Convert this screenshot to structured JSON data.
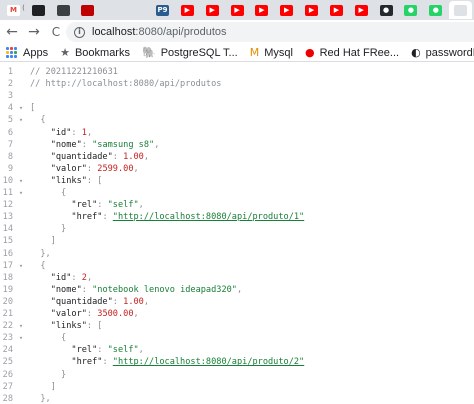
{
  "tabs": [
    {
      "icon": "gmail-icon",
      "label": "M",
      "color": "#ea4335",
      "bg": "#ffffff",
      "close": "(",
      "active": false
    },
    {
      "icon": "tab-dark-icon",
      "label": "",
      "color": "#202124",
      "bg": "#202124",
      "close": "",
      "active": false
    },
    {
      "icon": "tab-dark-icon",
      "label": "",
      "color": "#202124",
      "bg": "#3c4043",
      "close": "",
      "active": false
    },
    {
      "icon": "youtube-music-icon",
      "label": "",
      "color": "#c00000",
      "bg": "#c00000",
      "close": "",
      "active": false
    },
    {
      "icon": "tab-blank-icon",
      "label": "",
      "color": "#5f6368",
      "bg": "#dee1e6",
      "close": "",
      "active": false
    },
    {
      "icon": "tab-blank-icon",
      "label": "",
      "color": "#5f6368",
      "bg": "#dee1e6",
      "close": "",
      "active": false
    },
    {
      "icon": "pg-icon",
      "label": "P9",
      "color": "#ffffff",
      "bg": "#2a5d8f",
      "close": "",
      "active": false
    },
    {
      "icon": "youtube-icon",
      "label": "▶",
      "color": "#ffffff",
      "bg": "#ff0000",
      "close": "",
      "active": false
    },
    {
      "icon": "youtube-icon",
      "label": "▶",
      "color": "#ffffff",
      "bg": "#ff0000",
      "close": "",
      "active": false
    },
    {
      "icon": "youtube-icon",
      "label": "▶",
      "color": "#ffffff",
      "bg": "#ff0000",
      "close": "",
      "active": false
    },
    {
      "icon": "youtube-icon",
      "label": "▶",
      "color": "#ffffff",
      "bg": "#ff0000",
      "close": "",
      "active": false
    },
    {
      "icon": "youtube-icon",
      "label": "▶",
      "color": "#ffffff",
      "bg": "#ff0000",
      "close": "",
      "active": false
    },
    {
      "icon": "youtube-icon",
      "label": "▶",
      "color": "#ffffff",
      "bg": "#ff0000",
      "close": "",
      "active": false
    },
    {
      "icon": "youtube-icon",
      "label": "▶",
      "color": "#ffffff",
      "bg": "#ff0000",
      "close": "",
      "active": false
    },
    {
      "icon": "youtube-icon",
      "label": "▶",
      "color": "#ffffff",
      "bg": "#ff0000",
      "close": "",
      "active": false
    },
    {
      "icon": "github-icon",
      "label": "●",
      "color": "#ffffff",
      "bg": "#24292e",
      "close": "",
      "active": false
    },
    {
      "icon": "whatsapp-icon",
      "label": "●",
      "color": "#ffffff",
      "bg": "#25d366",
      "close": "",
      "active": false
    },
    {
      "icon": "whatsapp-icon",
      "label": "●",
      "color": "#ffffff",
      "bg": "#25d366",
      "close": "",
      "active": false
    },
    {
      "icon": "tab-blank-icon",
      "label": "",
      "color": "#5f6368",
      "bg": "#dee1e6",
      "close": "",
      "active": true
    }
  ],
  "toolbar": {
    "back": "←",
    "forward": "→",
    "reload": "C",
    "url_host": "localhost",
    "url_path": ":8080/api/produtos"
  },
  "bookmarks": [
    {
      "icon": "apps-grid-icon",
      "label": "Apps"
    },
    {
      "icon": "bookmark-star-icon",
      "glyph": "★",
      "color": "#5f6368",
      "label": "Bookmarks"
    },
    {
      "icon": "postgresql-icon",
      "glyph": "🐘",
      "color": "#336791",
      "label": "PostgreSQL T..."
    },
    {
      "icon": "mysql-icon",
      "glyph": "M",
      "color": "#e48e00",
      "label": "Mysql"
    },
    {
      "icon": "redhat-icon",
      "glyph": "●",
      "color": "#ee0000",
      "label": "Red Hat FRee..."
    },
    {
      "icon": "password-recovery-icon",
      "glyph": "◐",
      "color": "#202124",
      "label": "passwordReco..."
    }
  ],
  "lines": [
    {
      "n": "1",
      "fold": "",
      "tokens": [
        {
          "t": "// 20211221210631",
          "c": "c-comment"
        }
      ]
    },
    {
      "n": "2",
      "fold": "",
      "tokens": [
        {
          "t": "// http://localhost:8080/api/produtos",
          "c": "c-comment"
        }
      ]
    },
    {
      "n": "3",
      "fold": "",
      "tokens": []
    },
    {
      "n": "4",
      "fold": "▾",
      "tokens": [
        {
          "t": "[",
          "c": "c-punct"
        }
      ]
    },
    {
      "n": "5",
      "fold": "▾",
      "tokens": [
        {
          "t": "  {",
          "c": "c-punct"
        }
      ]
    },
    {
      "n": "6",
      "fold": "",
      "tokens": [
        {
          "t": "    \"id\"",
          "c": "c-key"
        },
        {
          "t": ": ",
          "c": "c-punct"
        },
        {
          "t": "1",
          "c": "c-num"
        },
        {
          "t": ",",
          "c": "c-punct"
        }
      ]
    },
    {
      "n": "7",
      "fold": "",
      "tokens": [
        {
          "t": "    \"nome\"",
          "c": "c-key"
        },
        {
          "t": ": ",
          "c": "c-punct"
        },
        {
          "t": "\"samsung s8\"",
          "c": "c-str"
        },
        {
          "t": ",",
          "c": "c-punct"
        }
      ]
    },
    {
      "n": "8",
      "fold": "",
      "tokens": [
        {
          "t": "    \"quantidade\"",
          "c": "c-key"
        },
        {
          "t": ": ",
          "c": "c-punct"
        },
        {
          "t": "1.00",
          "c": "c-num"
        },
        {
          "t": ",",
          "c": "c-punct"
        }
      ]
    },
    {
      "n": "9",
      "fold": "",
      "tokens": [
        {
          "t": "    \"valor\"",
          "c": "c-key"
        },
        {
          "t": ": ",
          "c": "c-punct"
        },
        {
          "t": "2599.00",
          "c": "c-num"
        },
        {
          "t": ",",
          "c": "c-punct"
        }
      ]
    },
    {
      "n": "10",
      "fold": "▾",
      "tokens": [
        {
          "t": "    \"links\"",
          "c": "c-key"
        },
        {
          "t": ": [",
          "c": "c-punct"
        }
      ]
    },
    {
      "n": "11",
      "fold": "▾",
      "tokens": [
        {
          "t": "      {",
          "c": "c-punct"
        }
      ]
    },
    {
      "n": "12",
      "fold": "",
      "tokens": [
        {
          "t": "        \"rel\"",
          "c": "c-key"
        },
        {
          "t": ": ",
          "c": "c-punct"
        },
        {
          "t": "\"self\"",
          "c": "c-str"
        },
        {
          "t": ",",
          "c": "c-punct"
        }
      ]
    },
    {
      "n": "13",
      "fold": "",
      "tokens": [
        {
          "t": "        \"href\"",
          "c": "c-key"
        },
        {
          "t": ": ",
          "c": "c-punct"
        },
        {
          "t": "\"http://localhost:8080/api/produto/1\"",
          "c": "c-link"
        }
      ]
    },
    {
      "n": "14",
      "fold": "",
      "tokens": [
        {
          "t": "      }",
          "c": "c-punct"
        }
      ]
    },
    {
      "n": "15",
      "fold": "",
      "tokens": [
        {
          "t": "    ]",
          "c": "c-punct"
        }
      ]
    },
    {
      "n": "16",
      "fold": "",
      "tokens": [
        {
          "t": "  },",
          "c": "c-punct"
        }
      ]
    },
    {
      "n": "17",
      "fold": "▾",
      "tokens": [
        {
          "t": "  {",
          "c": "c-punct"
        }
      ]
    },
    {
      "n": "18",
      "fold": "",
      "tokens": [
        {
          "t": "    \"id\"",
          "c": "c-key"
        },
        {
          "t": ": ",
          "c": "c-punct"
        },
        {
          "t": "2",
          "c": "c-num"
        },
        {
          "t": ",",
          "c": "c-punct"
        }
      ]
    },
    {
      "n": "19",
      "fold": "",
      "tokens": [
        {
          "t": "    \"nome\"",
          "c": "c-key"
        },
        {
          "t": ": ",
          "c": "c-punct"
        },
        {
          "t": "\"notebook lenovo ideapad320\"",
          "c": "c-str"
        },
        {
          "t": ",",
          "c": "c-punct"
        }
      ]
    },
    {
      "n": "20",
      "fold": "",
      "tokens": [
        {
          "t": "    \"quantidade\"",
          "c": "c-key"
        },
        {
          "t": ": ",
          "c": "c-punct"
        },
        {
          "t": "1.00",
          "c": "c-num"
        },
        {
          "t": ",",
          "c": "c-punct"
        }
      ]
    },
    {
      "n": "21",
      "fold": "",
      "tokens": [
        {
          "t": "    \"valor\"",
          "c": "c-key"
        },
        {
          "t": ": ",
          "c": "c-punct"
        },
        {
          "t": "3500.00",
          "c": "c-num"
        },
        {
          "t": ",",
          "c": "c-punct"
        }
      ]
    },
    {
      "n": "22",
      "fold": "▾",
      "tokens": [
        {
          "t": "    \"links\"",
          "c": "c-key"
        },
        {
          "t": ": [",
          "c": "c-punct"
        }
      ]
    },
    {
      "n": "23",
      "fold": "▾",
      "tokens": [
        {
          "t": "      {",
          "c": "c-punct"
        }
      ]
    },
    {
      "n": "24",
      "fold": "",
      "tokens": [
        {
          "t": "        \"rel\"",
          "c": "c-key"
        },
        {
          "t": ": ",
          "c": "c-punct"
        },
        {
          "t": "\"self\"",
          "c": "c-str"
        },
        {
          "t": ",",
          "c": "c-punct"
        }
      ]
    },
    {
      "n": "25",
      "fold": "",
      "tokens": [
        {
          "t": "        \"href\"",
          "c": "c-key"
        },
        {
          "t": ": ",
          "c": "c-punct"
        },
        {
          "t": "\"http://localhost:8080/api/produto/2\"",
          "c": "c-link"
        }
      ]
    },
    {
      "n": "26",
      "fold": "",
      "tokens": [
        {
          "t": "      }",
          "c": "c-punct"
        }
      ]
    },
    {
      "n": "27",
      "fold": "",
      "tokens": [
        {
          "t": "    ]",
          "c": "c-punct"
        }
      ]
    },
    {
      "n": "28",
      "fold": "",
      "tokens": [
        {
          "t": "  },",
          "c": "c-punct"
        }
      ]
    }
  ]
}
